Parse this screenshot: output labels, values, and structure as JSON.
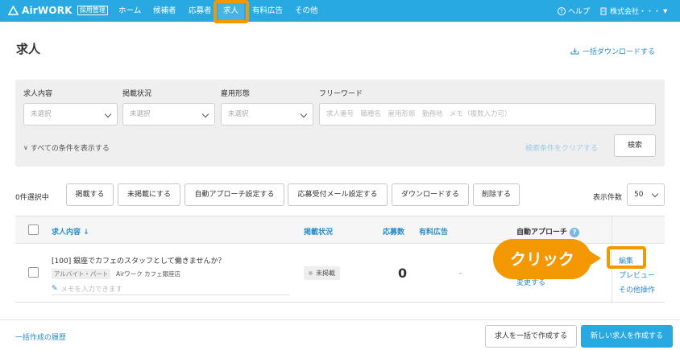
{
  "header": {
    "logo_text": "AirWORK",
    "logo_badge": "採用管理",
    "nav": [
      "ホーム",
      "候補者",
      "応募者",
      "求人",
      "有料広告",
      "その他"
    ],
    "active_nav": "求人",
    "help_label": "ヘルプ",
    "company_label": "株式会社・・・"
  },
  "page": {
    "title": "求人",
    "bulk_download": "一括ダウンロードする"
  },
  "filters": {
    "job_content_label": "求人内容",
    "job_content_value": "未選択",
    "status_label": "掲載状況",
    "status_value": "未選択",
    "employment_label": "雇用形態",
    "employment_value": "未選択",
    "freeword_label": "フリーワード",
    "freeword_placeholder": "求人番号　職種名　雇用形態　勤務地　メモ（複数入力可）",
    "show_all": "すべての条件を表示する",
    "clear": "検索条件をクリアする",
    "search": "検索"
  },
  "actions": {
    "selected_count": "0件選択中",
    "buttons": [
      "掲載する",
      "未掲載にする",
      "自動アプローチ設定する",
      "応募受付メール設定する",
      "ダウンロードする",
      "削除する"
    ],
    "per_page_label": "表示件数",
    "per_page_value": "50"
  },
  "table": {
    "headers": {
      "job_content": "求人内容",
      "status": "掲載状況",
      "applications": "応募数",
      "paid_ad": "有料広告",
      "auto_approach": "自動アプローチ"
    },
    "rows": [
      {
        "title": "[100] 銀座でカフェのスタッフとして働きませんか？",
        "employment_tag": "アルバイト・パート",
        "store": "Airワーク カフェ銀座店",
        "memo_placeholder": "メモを入力できます",
        "status": "未掲載",
        "applications": "0",
        "paid_ad": "-",
        "auto_approach_change": "変更する",
        "edit": "編集",
        "preview": "プレビュー",
        "other": "その他操作"
      }
    ]
  },
  "callout": {
    "text": "クリック"
  },
  "footer": {
    "history": "一括作成の履歴",
    "bulk_create": "求人を一括で作成する",
    "new_job": "新しい求人を作成する"
  },
  "colors": {
    "brand": "#29a9e1",
    "highlight": "#f39800",
    "link": "#2a8cc8"
  }
}
